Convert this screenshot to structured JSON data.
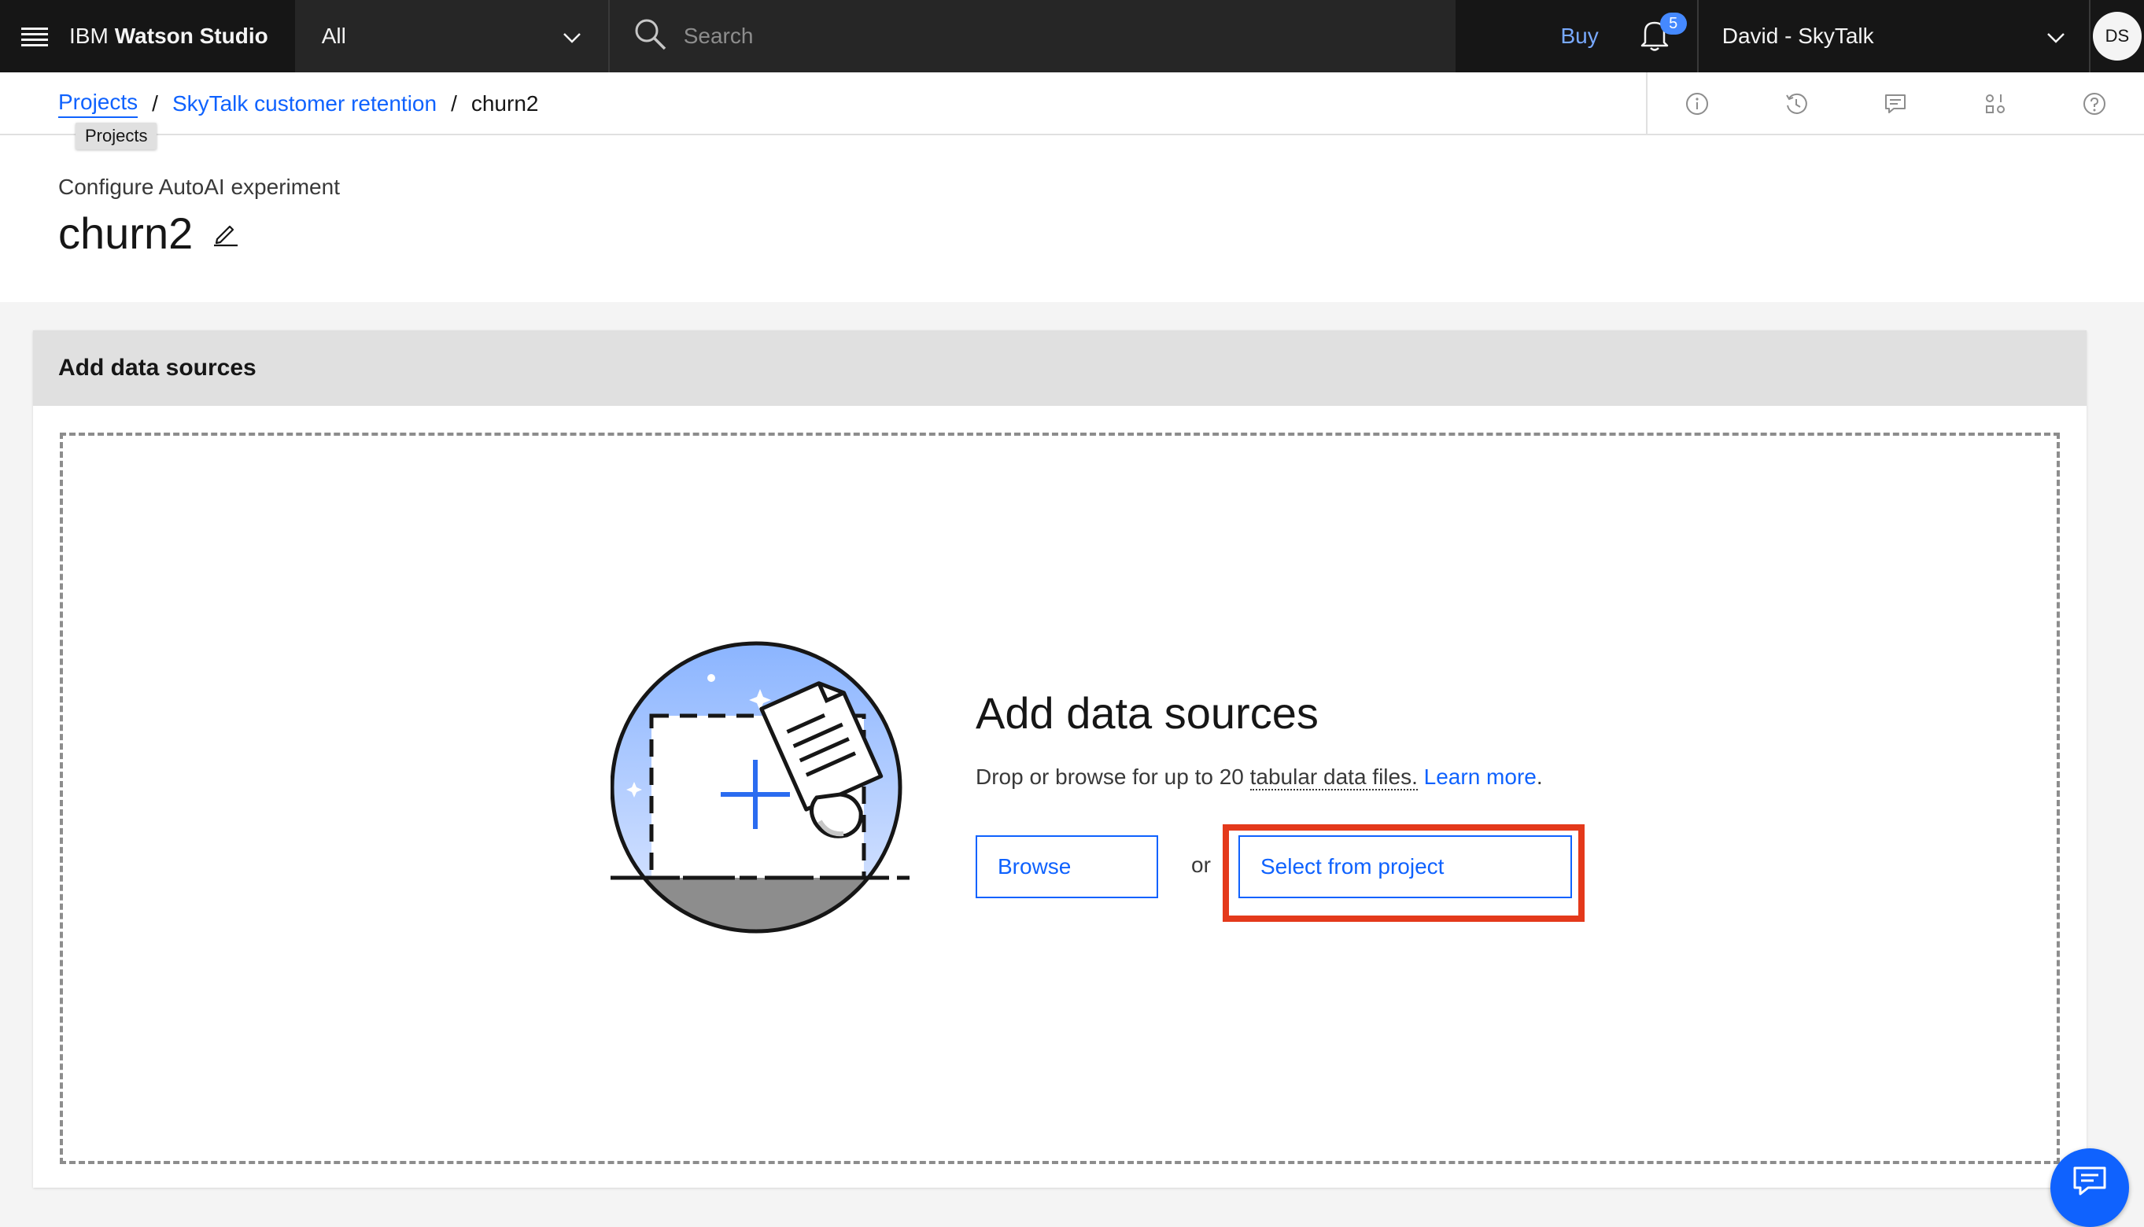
{
  "topbar": {
    "app_name_prefix": "IBM",
    "app_name": "Watson Studio",
    "scope_value": "All",
    "search_placeholder": "Search",
    "buy_label": "Buy",
    "notification_count": "5",
    "account_name": "David - SkyTalk",
    "avatar_initials": "DS"
  },
  "breadcrumb": {
    "items": [
      "Projects",
      "SkyTalk customer retention",
      "churn2"
    ],
    "separator": "/",
    "tooltip": "Projects"
  },
  "toolbar_icons": [
    "info-icon",
    "history-icon",
    "comment-icon",
    "settings-adjust-icon",
    "help-icon"
  ],
  "header": {
    "subtitle": "Configure AutoAI experiment",
    "title": "churn2"
  },
  "panel": {
    "heading": "Add data sources",
    "drop_title": "Add data sources",
    "drop_desc_prefix": "Drop or browse for up to 20 ",
    "drop_desc_term": "tabular data files.",
    "drop_desc_link": "Learn more",
    "drop_desc_suffix": ".",
    "browse_label": "Browse",
    "or_label": "or",
    "select_label": "Select from project"
  },
  "colors": {
    "topbar_bg": "#161616",
    "accent": "#0f62fe",
    "highlight": "#e4391b",
    "badge": "#4589ff"
  }
}
